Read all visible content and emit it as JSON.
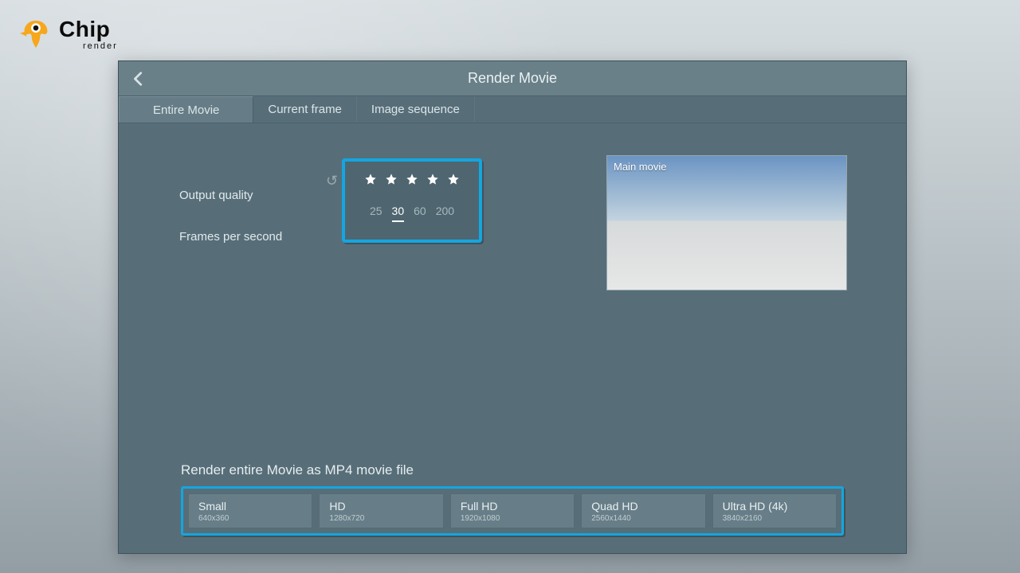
{
  "brand": {
    "main": "Chip",
    "sub": "render"
  },
  "dialog": {
    "title": "Render Movie",
    "tabs": [
      {
        "label": "Entire Movie",
        "active": true
      },
      {
        "label": "Current frame",
        "active": false
      },
      {
        "label": "Image sequence",
        "active": false
      }
    ],
    "labels": {
      "quality": "Output quality",
      "fps": "Frames per second"
    },
    "stars": 5,
    "fps_options": [
      {
        "label": "25",
        "active": false
      },
      {
        "label": "30",
        "active": true
      },
      {
        "label": "60",
        "active": false
      },
      {
        "label": "200",
        "active": false
      }
    ],
    "preview_label": "Main movie",
    "render_heading": "Render entire Movie as MP4 movie file",
    "render_options": [
      {
        "name": "Small",
        "res": "640x360"
      },
      {
        "name": "HD",
        "res": "1280x720"
      },
      {
        "name": "Full HD",
        "res": "1920x1080"
      },
      {
        "name": "Quad HD",
        "res": "2560x1440"
      },
      {
        "name": "Ultra HD (4k)",
        "res": "3840x2160"
      }
    ]
  }
}
